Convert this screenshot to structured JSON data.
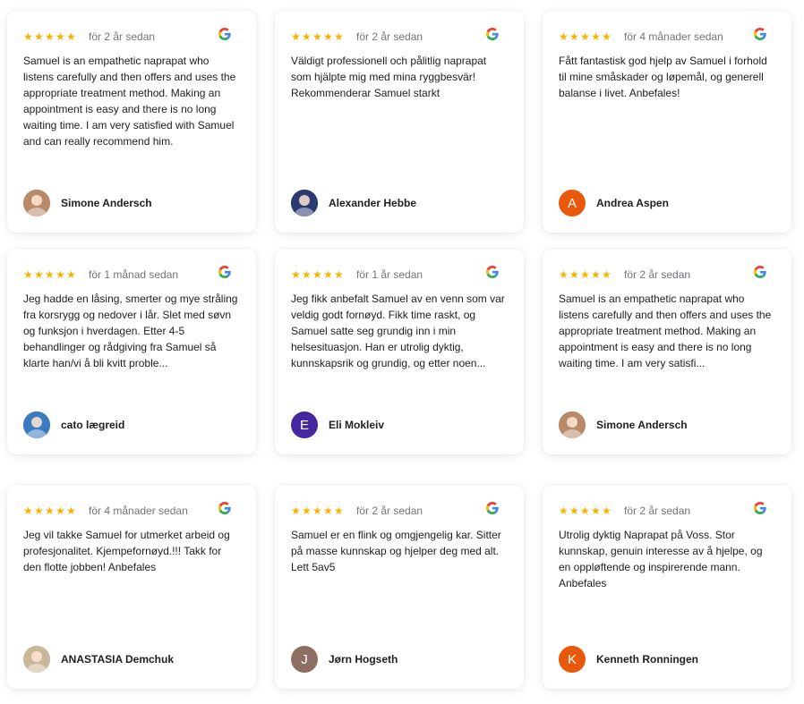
{
  "reviews": [
    {
      "rating": 5,
      "date": "för 2 år sedan",
      "text": "Samuel is an empathetic naprapat who listens carefully and then offers and uses the appropriate treatment method. Making an appointment is easy and there is no long waiting time. I am very satisfied with Samuel and can really recommend him.",
      "author": "Simone Andersch",
      "avatar": {
        "type": "photo",
        "color": "#b88a6a"
      }
    },
    {
      "rating": 5,
      "date": "för 2 år sedan",
      "text": "Väldigt professionell och pålitlig naprapat som hjälpte mig med mina ryggbesvär! Rekommenderar Samuel starkt",
      "author": "Alexander Hebbe",
      "avatar": {
        "type": "photo",
        "color": "#2a3a70"
      }
    },
    {
      "rating": 5,
      "date": "för 4 månader sedan",
      "text": "Fått fantastisk god hjelp av Samuel i forhold til mine småskader og løpemål, og generell balanse i livet. Anbefales!",
      "author": "Andrea Aspen",
      "avatar": {
        "type": "letter",
        "letter": "A",
        "color": "#e8590c"
      }
    },
    {
      "rating": 5,
      "date": "för 1 månad sedan",
      "text": "Jeg hadde en låsing, smerter og mye stråling fra korsrygg og nedover i lår. Slet med søvn og funksjon i hverdagen. Etter 4-5 behandlinger og rådgiving fra Samuel så klarte han/vi å bli kvitt proble...",
      "author": "cato lægreid",
      "avatar": {
        "type": "photo",
        "color": "#3a7bbf"
      }
    },
    {
      "rating": 5,
      "date": "för 1 år sedan",
      "text": "Jeg fikk anbefalt Samuel av en venn som var veldig godt fornøyd. Fikk time raskt, og Samuel satte seg grundig inn i min helsesituasjon. Han er utrolig dyktig, kunnskapsrik og grundig, og etter noen...",
      "author": "Eli Mokleiv",
      "avatar": {
        "type": "letter",
        "letter": "E",
        "color": "#4527a0"
      }
    },
    {
      "rating": 5,
      "date": "för 2 år sedan",
      "text": "Samuel is an empathetic naprapat who listens carefully and then offers and uses the appropriate treatment method. Making an appointment is easy and there is no long waiting time. I am very satisfi...",
      "author": "Simone Andersch",
      "avatar": {
        "type": "photo",
        "color": "#b88a6a"
      }
    },
    {
      "rating": 5,
      "date": "för 4 månader sedan",
      "text": "Jeg vil takke Samuel for utmerket arbeid og profesjonalitet. Kjempefornøyd.!!! Takk for den flotte jobben! Anbefales",
      "author": "ANASTASIA Demchuk",
      "avatar": {
        "type": "photo",
        "color": "#c9b79a"
      }
    },
    {
      "rating": 5,
      "date": "för 2 år sedan",
      "text": "Samuel er en flink og omgjengelig kar. Sitter på masse kunnskap og hjelper deg med alt. Lett 5av5",
      "author": "Jørn Hogseth",
      "avatar": {
        "type": "letter",
        "letter": "J",
        "color": "#8d6e63"
      }
    },
    {
      "rating": 5,
      "date": "för 2 år sedan",
      "text": "Utrolig dyktig Naprapat på Voss. Stor kunnskap, genuin interesse av å hjelpe, og en oppløftende og inspirerende mann. Anbefales",
      "author": "Kenneth Ronningen",
      "avatar": {
        "type": "letter",
        "letter": "K",
        "color": "#e8590c"
      }
    }
  ],
  "icons": {
    "star": "star-icon",
    "source": "google-logo-icon"
  },
  "colors": {
    "star": "#f4b400",
    "date": "#70757a",
    "text": "#202124"
  }
}
